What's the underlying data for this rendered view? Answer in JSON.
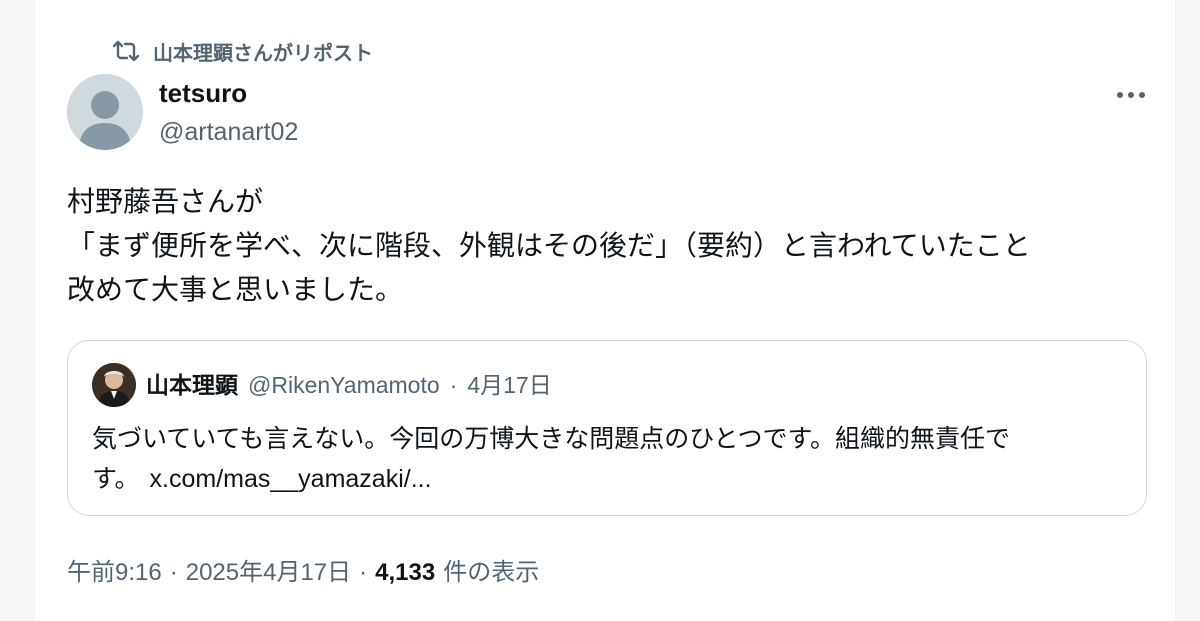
{
  "repost": {
    "icon": "repost-icon",
    "label": "山本理顕さんがリポスト"
  },
  "post": {
    "author_name": "tetsuro",
    "author_handle": "@artanart02",
    "avatar_icon": "default-avatar-icon",
    "more_icon": "more-options-icon",
    "text_lines": [
      "村野藤吾さんが",
      "「まず便所を学べ、次に階段、外観はその後だ」（要約）と言われていたこと",
      "改めて大事と思いました。"
    ]
  },
  "quote": {
    "author_name": "山本理顕",
    "author_handle": "@RikenYamamoto",
    "separator": "·",
    "date": "4月17日",
    "text_line1": "気づいていても言えない。今回の万博大きな問題点のひとつです。組織的無責任で",
    "text_line2": "す。",
    "link_text": "x.com/mas__yamazaki/..."
  },
  "meta": {
    "time": "午前9:16",
    "separator": "·",
    "date": "2025年4月17日",
    "views_count": "4,133",
    "views_label": "件の表示"
  },
  "colors": {
    "text_primary": "#0f1419",
    "text_secondary": "#536471",
    "border": "#cfd9de"
  }
}
